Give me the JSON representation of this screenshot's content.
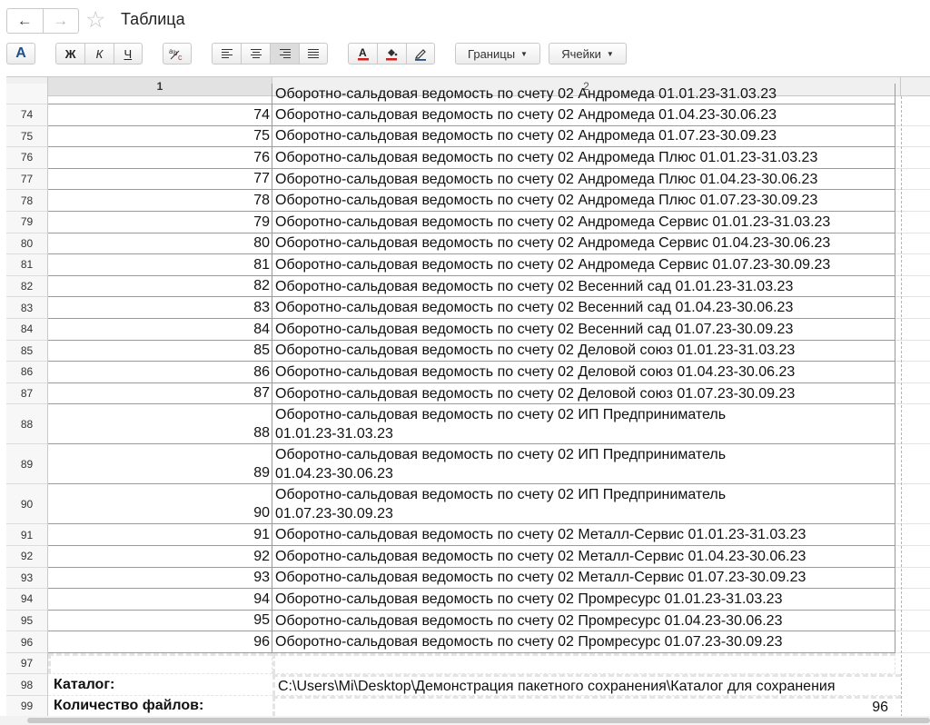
{
  "window": {
    "title": "Таблица"
  },
  "toolbar": {
    "font_color_btn": "A",
    "bold": "Ж",
    "italic": "К",
    "underline": "Ч",
    "borders_label": "Границы",
    "cells_label": "Ячейки"
  },
  "columns": [
    "1",
    "2"
  ],
  "partial_row_text": "Оборотно-сальдовая ведомость по счету 02 Андромеда 01.01.23-31.03.23",
  "rows": [
    {
      "n": "74",
      "v": "74",
      "t": "Оборотно-сальдовая ведомость по счету 02 Андромеда 01.04.23-30.06.23"
    },
    {
      "n": "75",
      "v": "75",
      "t": "Оборотно-сальдовая ведомость по счету 02 Андромеда 01.07.23-30.09.23"
    },
    {
      "n": "76",
      "v": "76",
      "t": "Оборотно-сальдовая ведомость по счету 02 Андромеда Плюс 01.01.23-31.03.23"
    },
    {
      "n": "77",
      "v": "77",
      "t": "Оборотно-сальдовая ведомость по счету 02 Андромеда Плюс 01.04.23-30.06.23"
    },
    {
      "n": "78",
      "v": "78",
      "t": "Оборотно-сальдовая ведомость по счету 02 Андромеда Плюс 01.07.23-30.09.23"
    },
    {
      "n": "79",
      "v": "79",
      "t": "Оборотно-сальдовая ведомость по счету 02 Андромеда Сервис 01.01.23-31.03.23"
    },
    {
      "n": "80",
      "v": "80",
      "t": "Оборотно-сальдовая ведомость по счету 02 Андромеда Сервис 01.04.23-30.06.23"
    },
    {
      "n": "81",
      "v": "81",
      "t": "Оборотно-сальдовая ведомость по счету 02 Андромеда Сервис 01.07.23-30.09.23"
    },
    {
      "n": "82",
      "v": "82",
      "t": "Оборотно-сальдовая ведомость по счету 02 Весенний сад 01.01.23-31.03.23"
    },
    {
      "n": "83",
      "v": "83",
      "t": "Оборотно-сальдовая ведомость по счету 02 Весенний сад 01.04.23-30.06.23"
    },
    {
      "n": "84",
      "v": "84",
      "t": "Оборотно-сальдовая ведомость по счету 02 Весенний сад 01.07.23-30.09.23"
    },
    {
      "n": "85",
      "v": "85",
      "t": "Оборотно-сальдовая ведомость по счету 02 Деловой союз 01.01.23-31.03.23"
    },
    {
      "n": "86",
      "v": "86",
      "t": "Оборотно-сальдовая ведомость по счету 02 Деловой союз 01.04.23-30.06.23"
    },
    {
      "n": "87",
      "v": "87",
      "t": "Оборотно-сальдовая ведомость по счету 02 Деловой союз 01.07.23-30.09.23"
    },
    {
      "n": "88",
      "v": "88",
      "t": "Оборотно-сальдовая ведомость по счету 02 ИП Предприниматель 01.01.23-31.03.23"
    },
    {
      "n": "89",
      "v": "89",
      "t": "Оборотно-сальдовая ведомость по счету 02 ИП Предприниматель 01.04.23-30.06.23"
    },
    {
      "n": "90",
      "v": "90",
      "t": "Оборотно-сальдовая ведомость по счету 02 ИП Предприниматель 01.07.23-30.09.23"
    },
    {
      "n": "91",
      "v": "91",
      "t": "Оборотно-сальдовая ведомость по счету 02 Металл-Сервис 01.01.23-31.03.23"
    },
    {
      "n": "92",
      "v": "92",
      "t": "Оборотно-сальдовая ведомость по счету 02 Металл-Сервис 01.04.23-30.06.23"
    },
    {
      "n": "93",
      "v": "93",
      "t": "Оборотно-сальдовая ведомость по счету 02 Металл-Сервис 01.07.23-30.09.23"
    },
    {
      "n": "94",
      "v": "94",
      "t": "Оборотно-сальдовая ведомость по счету 02 Промресурс 01.01.23-31.03.23"
    },
    {
      "n": "95",
      "v": "95",
      "t": "Оборотно-сальдовая ведомость по счету 02 Промресурс 01.04.23-30.06.23"
    },
    {
      "n": "96",
      "v": "96",
      "t": "Оборотно-сальдовая ведомость по счету 02 Промресурс 01.07.23-30.09.23"
    }
  ],
  "footer": {
    "row97": "97",
    "row98": "98",
    "row99": "99",
    "catalog_label": "Каталог:",
    "catalog_value": "C:\\Users\\Mi\\Desktop\\Демонстрация пакетного сохранения\\Каталог для сохранения",
    "count_label": "Количество файлов:",
    "count_value": "96"
  }
}
